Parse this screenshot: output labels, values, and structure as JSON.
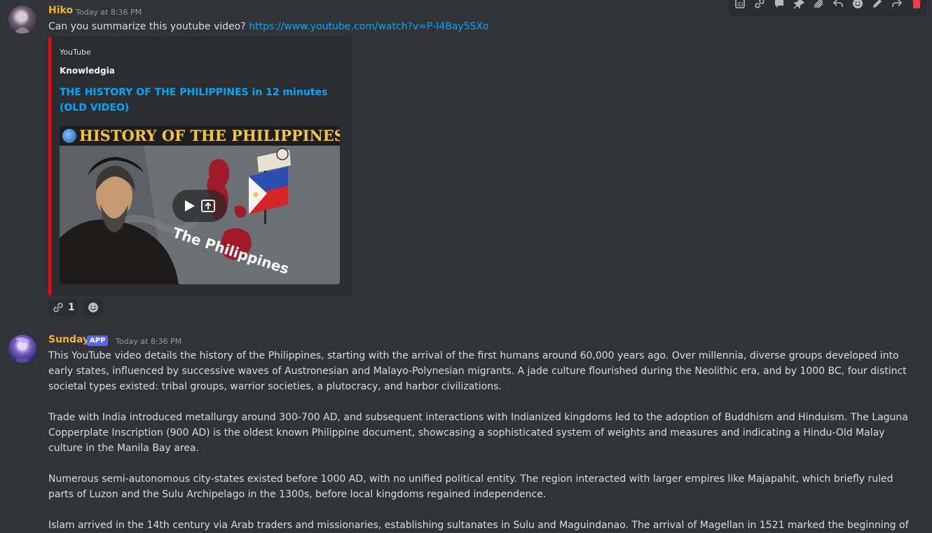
{
  "toolbar": {
    "icons": [
      "thread-icon",
      "link-icon",
      "reply-bubble-icon",
      "pin-icon",
      "sparkle-icon",
      "reply-icon",
      "emoji-icon",
      "edit-icon",
      "forward-icon",
      "delete-icon"
    ]
  },
  "messages": [
    {
      "username": "Hiko",
      "timestamp": "Today at 8:36 PM",
      "text_prefix": "Can you summarize this youtube video? ",
      "link": "https://www.youtube.com/watch?v=P-I4Bay5SXo",
      "embed": {
        "provider": "YouTube",
        "author": "Knowledgia",
        "title": "THE HISTORY OF THE PHILIPPINES in 12 minutes (OLD VIDEO)",
        "thumbnail_banner": "HISTORY OF THE PHILIPPINES",
        "thumbnail_overlay_text": "The Philippines",
        "accent_color": "#ff0000"
      },
      "reactions": [
        {
          "icon": "link-icon",
          "count": "1"
        },
        {
          "icon": "add-reaction-icon",
          "count": ""
        }
      ]
    },
    {
      "username": "Sunday",
      "badge": "APP",
      "timestamp": "Today at 8:36 PM",
      "paragraphs": [
        "This YouTube video details the history of the Philippines, starting with the arrival of the first humans around 60,000 years ago.  Over millennia, diverse groups developed into early states, influenced by successive waves of Austronesian and Malayo-Polynesian migrants.  A jade culture flourished during the Neolithic era, and by 1000 BC, four distinct societal types existed: tribal groups, warrior societies, a plutocracy, and harbor civilizations.",
        "Trade with India introduced metallurgy around 300-700 AD, and subsequent interactions with Indianized kingdoms led to the adoption of Buddhism and Hinduism.  The Laguna Copperplate Inscription (900 AD) is the oldest known Philippine document, showcasing a sophisticated system of weights and measures and indicating a Hindu-Old Malay culture in the Manila Bay area.",
        "Numerous semi-autonomous city-states existed before 1000 AD, with no unified political entity.  The region interacted with larger empires like Majapahit, which briefly ruled parts of Luzon and the Sulu Archipelago in the 1300s, before local kingdoms regained independence.",
        "Islam arrived in the 14th century via Arab traders and missionaries, establishing sultanates in Sulu and Maguindanao.  The arrival of Magellan in 1521 marked the beginning of"
      ]
    }
  ],
  "colors": {
    "background": "#313338",
    "hiko_name": "#f0b232",
    "sunday_name": "#f0b232",
    "link": "#00a8fc",
    "app_badge": "#5865f2"
  }
}
